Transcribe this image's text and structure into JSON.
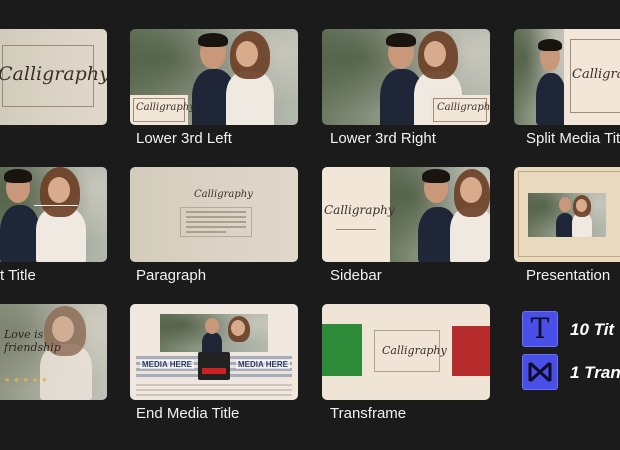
{
  "tiles": [
    {
      "id": "calligraphy-title",
      "label": "",
      "thumb_text": "Calligraphy"
    },
    {
      "id": "lower-3rd-left",
      "label": "Lower 3rd Left",
      "thumb_text": "Calligraphy"
    },
    {
      "id": "lower-3rd-right",
      "label": "Lower 3rd Right",
      "thumb_text": "Calligraphy"
    },
    {
      "id": "split-media-title",
      "label": "Split Media Title",
      "thumb_text": "Calligraphy"
    },
    {
      "id": "text-title",
      "label": "t Title"
    },
    {
      "id": "paragraph",
      "label": "Paragraph",
      "thumb_text": "Calligraphy"
    },
    {
      "id": "sidebar",
      "label": "Sidebar",
      "thumb_text": "Calligraphy"
    },
    {
      "id": "presentation",
      "label": "Presentation"
    },
    {
      "id": "quote-title",
      "label": "",
      "thumb_text": "Love is friendship"
    },
    {
      "id": "end-media-title",
      "label": "End Media Title",
      "thumb_text": "MEDIA HERE"
    },
    {
      "id": "transframe",
      "label": "Transframe",
      "thumb_text": "Calligraphy"
    }
  ],
  "legend": {
    "titles_icon": "T",
    "titles_text": "10 Tit",
    "transitions_text": "1 Tran"
  },
  "colors": {
    "background": "#1b1b1c",
    "legend_icon": "#4a4fe8",
    "transframe_green": "#2e8b3a",
    "transframe_red": "#b62b2b"
  }
}
